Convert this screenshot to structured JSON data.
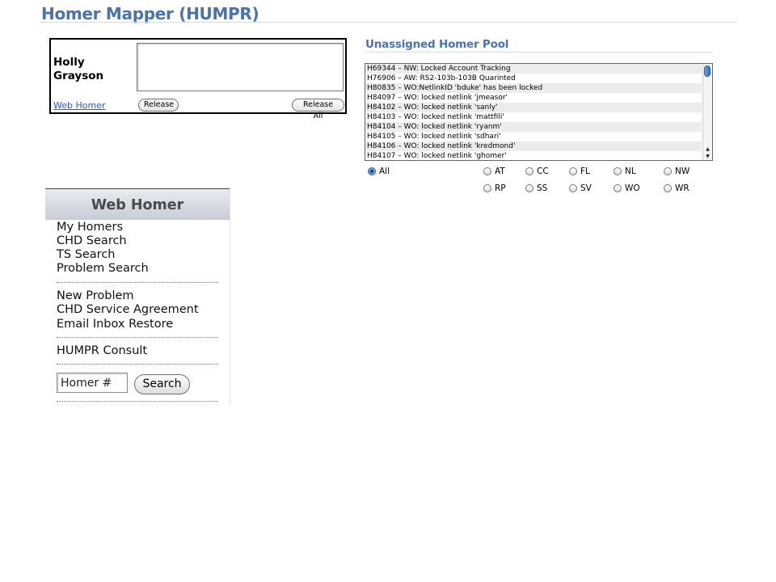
{
  "header": {
    "title": "Homer Mapper (HUMPR)"
  },
  "user_box": {
    "name_first": "Holly",
    "name_last": "Grayson",
    "link_label": "Web Homer",
    "release_label": "Release",
    "release_all_label": "Release All"
  },
  "pool": {
    "title": "Unassigned Homer Pool",
    "items": [
      "H69344 – NW: Locked Account Tracking",
      "H76906 – AW: RS2-103b-103B Quarinted",
      "H80835 – WO:NetlinkID 'bduke' has been locked",
      "H84097 – WO: locked netlink 'jmeasor'",
      "H84102 – WO: locked netlink 'sanly'",
      "H84103 – WO: locked netlink 'mattfili'",
      "H84104 – WO: locked netlink 'ryanm'",
      "H84105 – WO: locked netlink 'sdhari'",
      "H84106 – WO: locked netlink 'kredmond'",
      "H84107 – WO: locked netlink 'ghomer'"
    ],
    "filters": [
      {
        "label": "All",
        "checked": true
      },
      {
        "label": "AT",
        "checked": false
      },
      {
        "label": "CC",
        "checked": false
      },
      {
        "label": "FL",
        "checked": false
      },
      {
        "label": "NL",
        "checked": false
      },
      {
        "label": "NW",
        "checked": false
      },
      {
        "label": "RP",
        "checked": false
      },
      {
        "label": "SS",
        "checked": false
      },
      {
        "label": "SV",
        "checked": false
      },
      {
        "label": "WO",
        "checked": false
      },
      {
        "label": "WR",
        "checked": false
      }
    ]
  },
  "menu": {
    "title": "Web Homer",
    "group1": [
      "My Homers",
      "CHD Search",
      "TS Search",
      "Problem Search"
    ],
    "group2": [
      "New Problem",
      "CHD Service Agreement",
      "Email Inbox Restore"
    ],
    "group3": [
      "HUMPR Consult"
    ],
    "homer_input_value": "Homer #",
    "search_label": "Search"
  },
  "icons": {
    "scroll_up": "scroll-up-arrow-icon",
    "scroll_down": "scroll-down-arrow-icon"
  },
  "colors": {
    "title_blue": "#4a72ae",
    "link_blue": "#2a56c6",
    "radio_selected": "#4d8be0"
  }
}
